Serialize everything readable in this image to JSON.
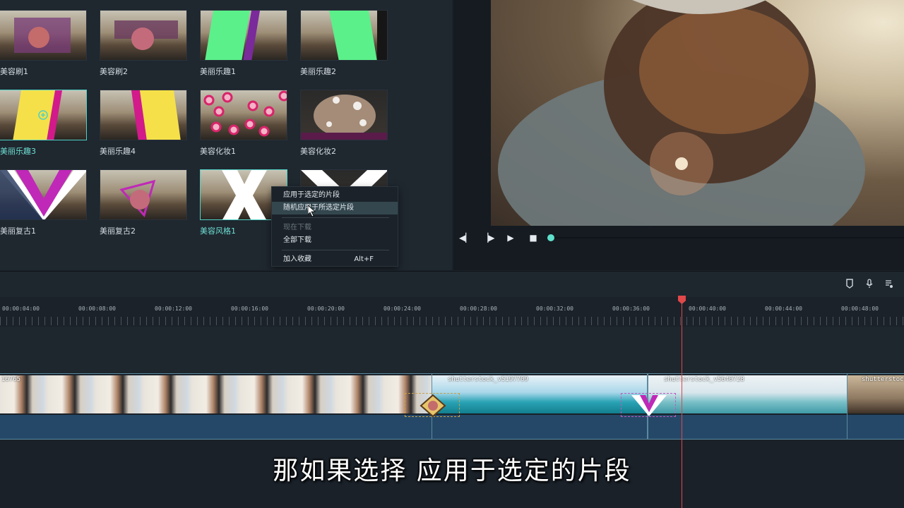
{
  "library": {
    "items": [
      {
        "label": "美容刷1"
      },
      {
        "label": "美容刷2"
      },
      {
        "label": "美丽乐趣1"
      },
      {
        "label": "美丽乐趣2"
      },
      {
        "label": "美丽乐趣3"
      },
      {
        "label": "美丽乐趣4"
      },
      {
        "label": "美容化妆1"
      },
      {
        "label": "美容化妆2"
      },
      {
        "label": "美丽复古1"
      },
      {
        "label": "美丽复古2"
      },
      {
        "label": "美容风格1"
      },
      {
        "label": ""
      }
    ]
  },
  "context_menu": {
    "apply_selected": "应用于选定的片段",
    "apply_random": "随机应用于所选定片段",
    "download_now": "现在下载",
    "download_all": "全部下载",
    "add_favorite": "加入收藏",
    "add_favorite_shortcut": "Alt+F"
  },
  "timeline": {
    "ticks": [
      "00:00:04:00",
      "00:00:08:00",
      "00:00:12:00",
      "00:00:16:00",
      "00:00:20:00",
      "00:00:24:00",
      "00:00:28:00",
      "00:00:32:00",
      "00:00:36:00",
      "00:00:40:00",
      "00:00:44:00",
      "00:00:48:00"
    ],
    "clips": [
      {
        "name": "16765"
      },
      {
        "name": "shutterstock_v5197709"
      },
      {
        "name": "shutterstock_v5640728"
      },
      {
        "name": "shutterstock"
      }
    ]
  },
  "subtitle": "那如果选择  应用于选定的片段",
  "colors": {
    "accent": "#4fd1c5",
    "playhead": "#e0484a"
  }
}
